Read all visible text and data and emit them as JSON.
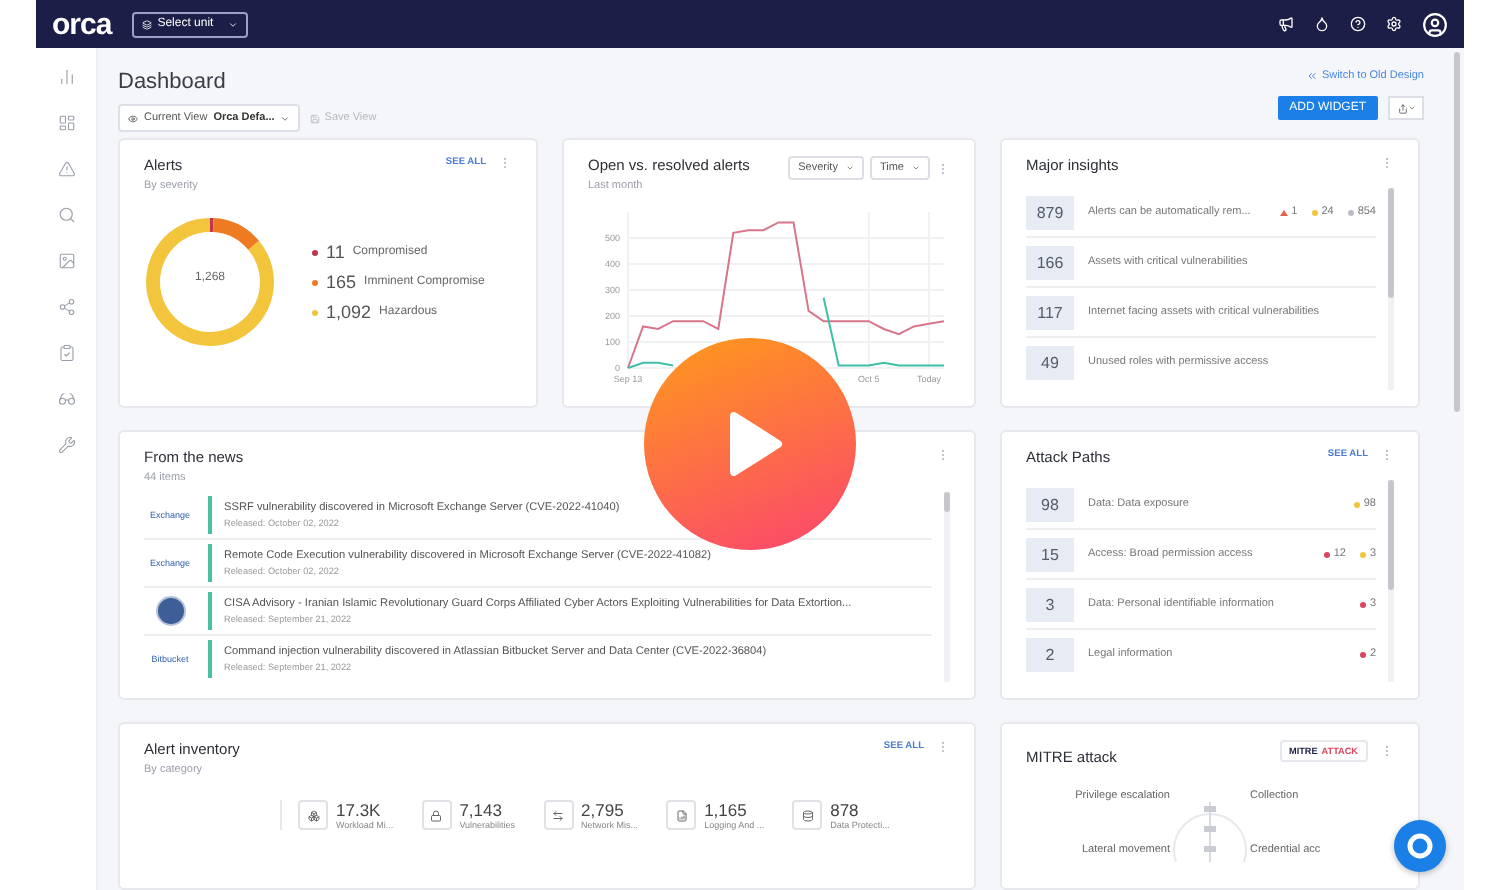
{
  "topbar": {
    "logo": "orca",
    "unit_select": "Select unit"
  },
  "header": {
    "title": "Dashboard",
    "current_view_label": "Current View",
    "current_view_value": "Orca Defa...",
    "save_view": {
      "label": "Save View",
      "disabled": true
    },
    "switch_design": "Switch to Old Design",
    "add_widget": "ADD WIDGET"
  },
  "alerts": {
    "title": "Alerts",
    "subtitle": "By severity",
    "see_all": "SEE ALL",
    "total": "1,268",
    "items": [
      {
        "count": "11",
        "label": "Compromised",
        "color": "#c2334d"
      },
      {
        "count": "165",
        "label": "Imminent Compromise",
        "color": "#ee7a22"
      },
      {
        "count": "1,092",
        "label": "Hazardous",
        "color": "#f2c53d"
      }
    ],
    "chart_data": {
      "type": "donut",
      "series": [
        {
          "values": [
            0.9,
            13.0,
            86.1
          ]
        }
      ]
    }
  },
  "open_resolved": {
    "title": "Open vs. resolved alerts",
    "subtitle": "Last month",
    "filters": [
      "Severity",
      "Time"
    ],
    "chart_data": {
      "type": "line",
      "categories": [
        "Sep 13",
        null,
        null,
        null,
        null,
        null,
        null,
        null,
        null,
        null,
        null,
        null,
        null,
        null,
        null,
        null,
        "Oct 5",
        null,
        null,
        null,
        "Today",
        null
      ],
      "grid": true,
      "ylim": [
        0,
        600
      ],
      "yticks": [
        0,
        100,
        200,
        300,
        400,
        500
      ],
      "series": [
        {
          "color": "#d7768b",
          "values": [
            0,
            160,
            150,
            180,
            180,
            180,
            150,
            520,
            530,
            530,
            560,
            560,
            220,
            180,
            180,
            180,
            180,
            150,
            130,
            160,
            170,
            180
          ]
        },
        {
          "color": "#3fbfa5",
          "values": [
            0,
            20,
            20,
            10,
            null,
            null,
            null,
            null,
            null,
            null,
            null,
            null,
            null,
            270,
            10,
            10,
            10,
            20,
            10,
            10,
            10,
            10
          ]
        }
      ]
    }
  },
  "insights": {
    "title": "Major insights",
    "rows": [
      {
        "count": "879",
        "label": "Alerts can be automatically rem...",
        "badges": [
          {
            "kind": "triangle",
            "count": "1",
            "color": "#e0624a"
          },
          {
            "kind": "dot",
            "count": "24",
            "color": "#f2c53d"
          },
          {
            "kind": "dot",
            "count": "854",
            "color": "#b9bcc4"
          }
        ]
      },
      {
        "count": "166",
        "label": "Assets with critical vulnerabilities",
        "badges": []
      },
      {
        "count": "117",
        "label": "Internet facing assets with critical vulnerabilities",
        "badges": []
      },
      {
        "count": "49",
        "label": "Unused roles with permissive access",
        "badges": []
      }
    ]
  },
  "news": {
    "title": "From the news",
    "count": "44 items",
    "items": [
      {
        "logo": {
          "kind": "text",
          "text": "Exchange"
        },
        "title": "SSRF vulnerability discovered in Microsoft Exchange Server (CVE-2022-41040)",
        "released_label": "Released:",
        "date": "October 02, 2022"
      },
      {
        "logo": {
          "kind": "text",
          "text": "Exchange"
        },
        "title": "Remote Code Execution vulnerability discovered in Microsoft Exchange Server (CVE-2022-41082)",
        "released_label": "Released:",
        "date": "October 02, 2022"
      },
      {
        "logo": {
          "kind": "seal"
        },
        "title": "CISA Advisory - Iranian Islamic Revolutionary Guard Corps Affiliated Cyber Actors Exploiting Vulnerabilities for Data Extortion...",
        "released_label": "Released:",
        "date": "September 21, 2022"
      },
      {
        "logo": {
          "kind": "text",
          "text": "Bitbucket"
        },
        "title": "Command injection vulnerability discovered in Atlassian Bitbucket Server and Data Center (CVE-2022-36804)",
        "released_label": "Released:",
        "date": "September 21, 2022"
      }
    ]
  },
  "attack_paths": {
    "title": "Attack Paths",
    "see_all": "SEE ALL",
    "rows": [
      {
        "count": "98",
        "label": "Data: Data exposure",
        "badges": [
          {
            "kind": "dot",
            "count": "98",
            "color": "#f2c53d"
          }
        ]
      },
      {
        "count": "15",
        "label": "Access: Broad permission access",
        "badges": [
          {
            "kind": "dot",
            "count": "12",
            "color": "#d9465e"
          },
          {
            "kind": "dot",
            "count": "3",
            "color": "#f2c53d"
          }
        ]
      },
      {
        "count": "3",
        "label": "Data: Personal identifiable information",
        "badges": [
          {
            "kind": "dot",
            "count": "3",
            "color": "#d9465e"
          }
        ]
      },
      {
        "count": "2",
        "label": "Legal information",
        "badges": [
          {
            "kind": "dot",
            "count": "2",
            "color": "#d9465e"
          }
        ]
      }
    ]
  },
  "inventory": {
    "title": "Alert inventory",
    "subtitle": "By category",
    "see_all": "SEE ALL",
    "categories": [
      {
        "kind": "workload",
        "value": "17.3K",
        "label": "Workload Mi..."
      },
      {
        "kind": "vulnerabilities",
        "value": "7,143",
        "label": "Vulnerabilities"
      },
      {
        "kind": "network",
        "value": "2,795",
        "label": "Network Mis..."
      },
      {
        "kind": "logging",
        "value": "1,165",
        "label": "Logging And ..."
      },
      {
        "kind": "data",
        "value": "878",
        "label": "Data Protecti..."
      }
    ]
  },
  "mitre": {
    "title": "MITRE attack",
    "badge": [
      "MITRE",
      "ATTACK"
    ],
    "labels_left": [
      "Privilege escalation",
      "Lateral movement"
    ],
    "labels_right": [
      "Collection",
      "Credential acc"
    ]
  }
}
